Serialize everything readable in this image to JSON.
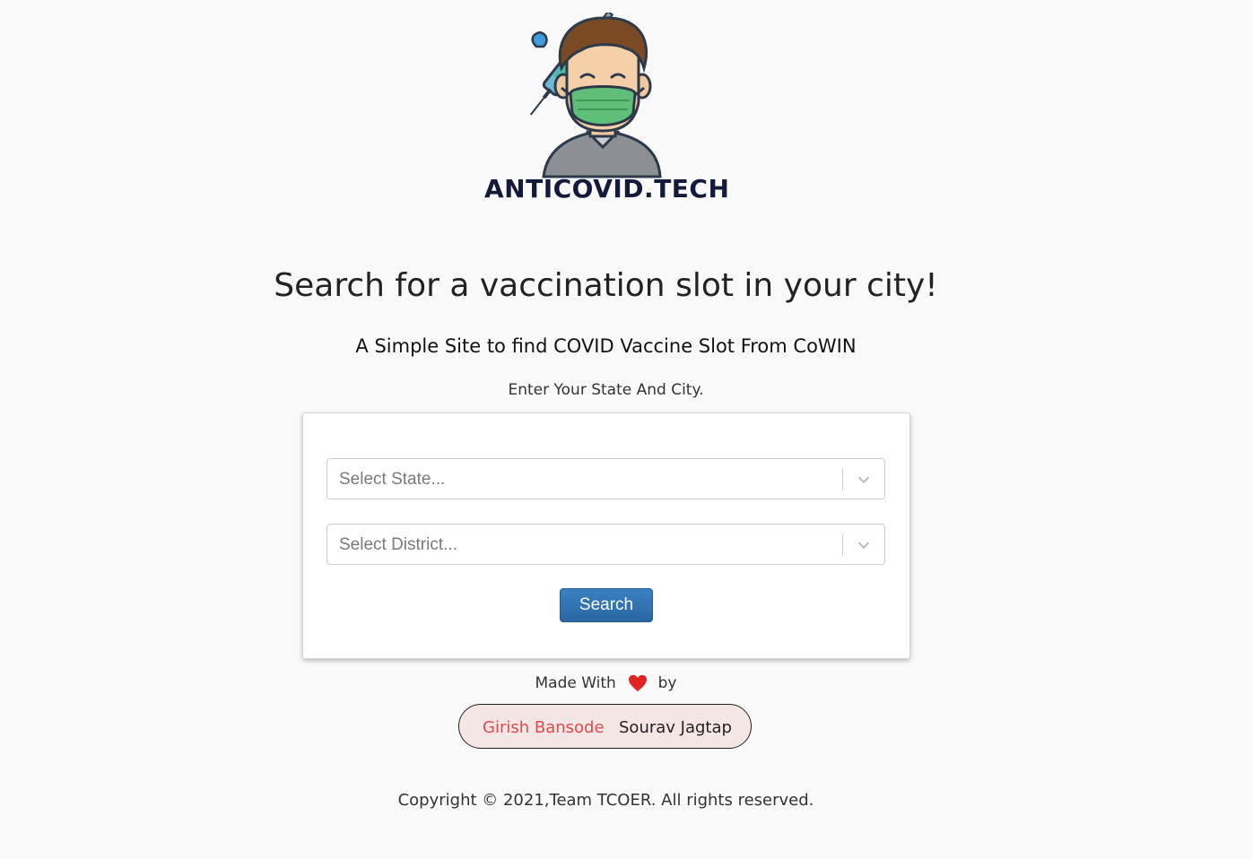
{
  "logo": {
    "text": "ANTICOVID.TECH"
  },
  "hero": {
    "title": "Search for a vaccination slot in your city!",
    "subtitle": "A Simple Site to find COVID Vaccine Slot From CoWIN",
    "instruction": "Enter Your State And City."
  },
  "form": {
    "state_placeholder": "Select State...",
    "district_placeholder": "Select District...",
    "search_label": "Search",
    "button_color": "#2a67a3"
  },
  "footer": {
    "made_with_prefix": "Made With",
    "made_with_suffix": "by",
    "heart_icon": "heart-icon",
    "heart_color": "#e02424",
    "authors": [
      "Girish Bansode",
      "Sourav Jagtap"
    ],
    "copyright": "Copyright © 2021,Team TCOER. All rights reserved."
  }
}
